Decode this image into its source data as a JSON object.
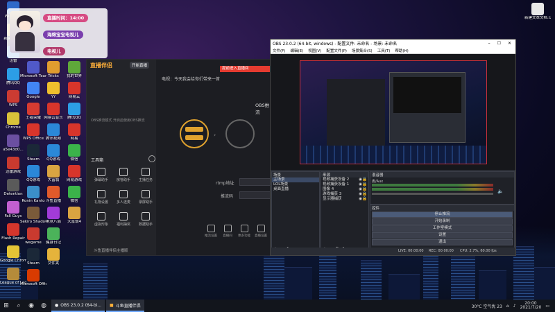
{
  "overlay": {
    "live_time_label": "直播时间：14:00",
    "brand_label": "海绵宝宝电视儿",
    "sub_label": "电视儿"
  },
  "desktop_icons_col1": [
    {
      "label": "Windows",
      "color": "#2e69c9"
    },
    {
      "label": "新建文件夹",
      "color": "#e5b33b"
    },
    {
      "label": "迅雷",
      "color": "#2d7bd9"
    },
    {
      "label": "腾讯QQ",
      "color": "#2c9ee6"
    },
    {
      "label": "WPS",
      "color": "#cc3b32"
    },
    {
      "label": "Chrome",
      "color": "#d8c23a"
    },
    {
      "label": "a5e43d0...",
      "color": "#6b4fa1"
    },
    {
      "label": "迅雷游戏",
      "color": "#c93a2f"
    },
    {
      "label": "Detention",
      "color": "#5a5a5a"
    },
    {
      "label": "Fall Guys",
      "color": "#c25fd0"
    },
    {
      "label": "Flash Repair",
      "color": "#d6362c"
    },
    {
      "label": "Google Chrome",
      "color": "#e4c436"
    },
    {
      "label": "League of Legends",
      "color": "#b58b3a"
    }
  ],
  "desktop_icons_col2": [
    {
      "label": "Microsoft Teams",
      "color": "#5059c9"
    },
    {
      "label": "Google",
      "color": "#4285f4"
    },
    {
      "label": "王者荣耀",
      "color": "#d63b31"
    },
    {
      "label": "WPS Office",
      "color": "#d8352b"
    },
    {
      "label": "Steam",
      "color": "#1b2838"
    },
    {
      "label": "QQ游戏",
      "color": "#2b88d8"
    },
    {
      "label": "Ronin Kanto",
      "color": "#3b8ec9"
    },
    {
      "label": "Sekiro Shadows...",
      "color": "#7a5a3a"
    },
    {
      "label": "wegame",
      "color": "#c93a2f"
    },
    {
      "label": "Steam",
      "color": "#1b2838"
    },
    {
      "label": "Microsoft Office",
      "color": "#d83b01"
    }
  ],
  "desktop_icons_col3": [
    {
      "label": "Tricks",
      "color": "#e09c2f"
    },
    {
      "label": "YY",
      "color": "#f0c02d"
    },
    {
      "label": "网易云音乐",
      "color": "#d8352b"
    },
    {
      "label": "腾讯视频",
      "color": "#2b88d8"
    },
    {
      "label": "QQ游戏",
      "color": "#2b88d8"
    },
    {
      "label": "大富翁",
      "color": "#d9a441"
    },
    {
      "label": "斗鱼直播",
      "color": "#e05a2a"
    },
    {
      "label": "电竞八局",
      "color": "#a23bd8"
    },
    {
      "label": "健身日记",
      "color": "#4bb35a"
    },
    {
      "label": "文件夹",
      "color": "#e5b33b"
    }
  ],
  "desktop_icons_col4": [
    {
      "label": "我的世界",
      "color": "#5fa83a"
    },
    {
      "label": "网易云",
      "color": "#d8352b"
    },
    {
      "label": "腾讯QQ",
      "color": "#2c9ee6"
    },
    {
      "label": "网易",
      "color": "#d8352b"
    },
    {
      "label": "微信",
      "color": "#3bb34a"
    },
    {
      "label": "网易游戏",
      "color": "#d8352b"
    },
    {
      "label": "微信",
      "color": "#3bb34a"
    },
    {
      "label": "大富翁4",
      "color": "#d9a441"
    }
  ],
  "desktop_right_icon": {
    "label": "新建文本文档.txt",
    "color": "#e8e8e8"
  },
  "streamer": {
    "title": "直播伴侣",
    "top_badge": "开始直播",
    "red_banner": "提前进入直播间",
    "info_line": "电视：今天我会给你们带来一首",
    "obs_label": "OBS推流",
    "rtmp_label": "rtmp地址",
    "key_label": "推流码",
    "tools_label": "工具箱",
    "tools": [
      "弹幕助手",
      "房管助手",
      "主播任务",
      "礼物设置",
      "多人连麦",
      "录屏助手",
      "虚拟形象",
      "福利抽奖",
      "数据助手"
    ],
    "left_hint": "OBS推流模式 开启后使用OBS推流",
    "bottom_actions": [
      "推流设置",
      "直播间",
      "更多功能",
      "直播设置"
    ],
    "footer": "斗鱼直播伴侣主播版"
  },
  "obs": {
    "title": "OBS 23.0.2 (64-bit, windows) - 配置文件: 未命名 - 场景: 未命名",
    "menu": [
      "文件(F)",
      "编辑(E)",
      "视图(V)",
      "配置文件(P)",
      "场景集合(S)",
      "工具(T)",
      "帮助(H)"
    ],
    "scenes_header": "场景",
    "scenes": [
      "主场景",
      "LOL场景",
      "桌面直播"
    ],
    "sources_header": "来源",
    "sources": [
      "视频捕获设备 2",
      "视频捕获设备 1",
      "图像 4",
      "游戏捕获 3",
      "显示器捕获"
    ],
    "mixer_header": "混音器",
    "mixer_items": [
      "麦/Aux",
      "桌面音频"
    ],
    "controls_header": "控件",
    "controls": [
      "停止推流",
      "开始录制",
      "工作室模式",
      "设置",
      "退出"
    ],
    "status": {
      "live": "LIVE: 00:00:00",
      "rec": "REC: 00:00:00",
      "cpu": "CPU: 2.7%, 60.00 fps"
    }
  },
  "taskbar": {
    "apps": [
      "OBS 23.0.2 (64-bi...",
      "斗鱼直播伴侣"
    ],
    "weather": "30°C 空气优 23",
    "time": "20:00",
    "date": "2021/7/20"
  }
}
